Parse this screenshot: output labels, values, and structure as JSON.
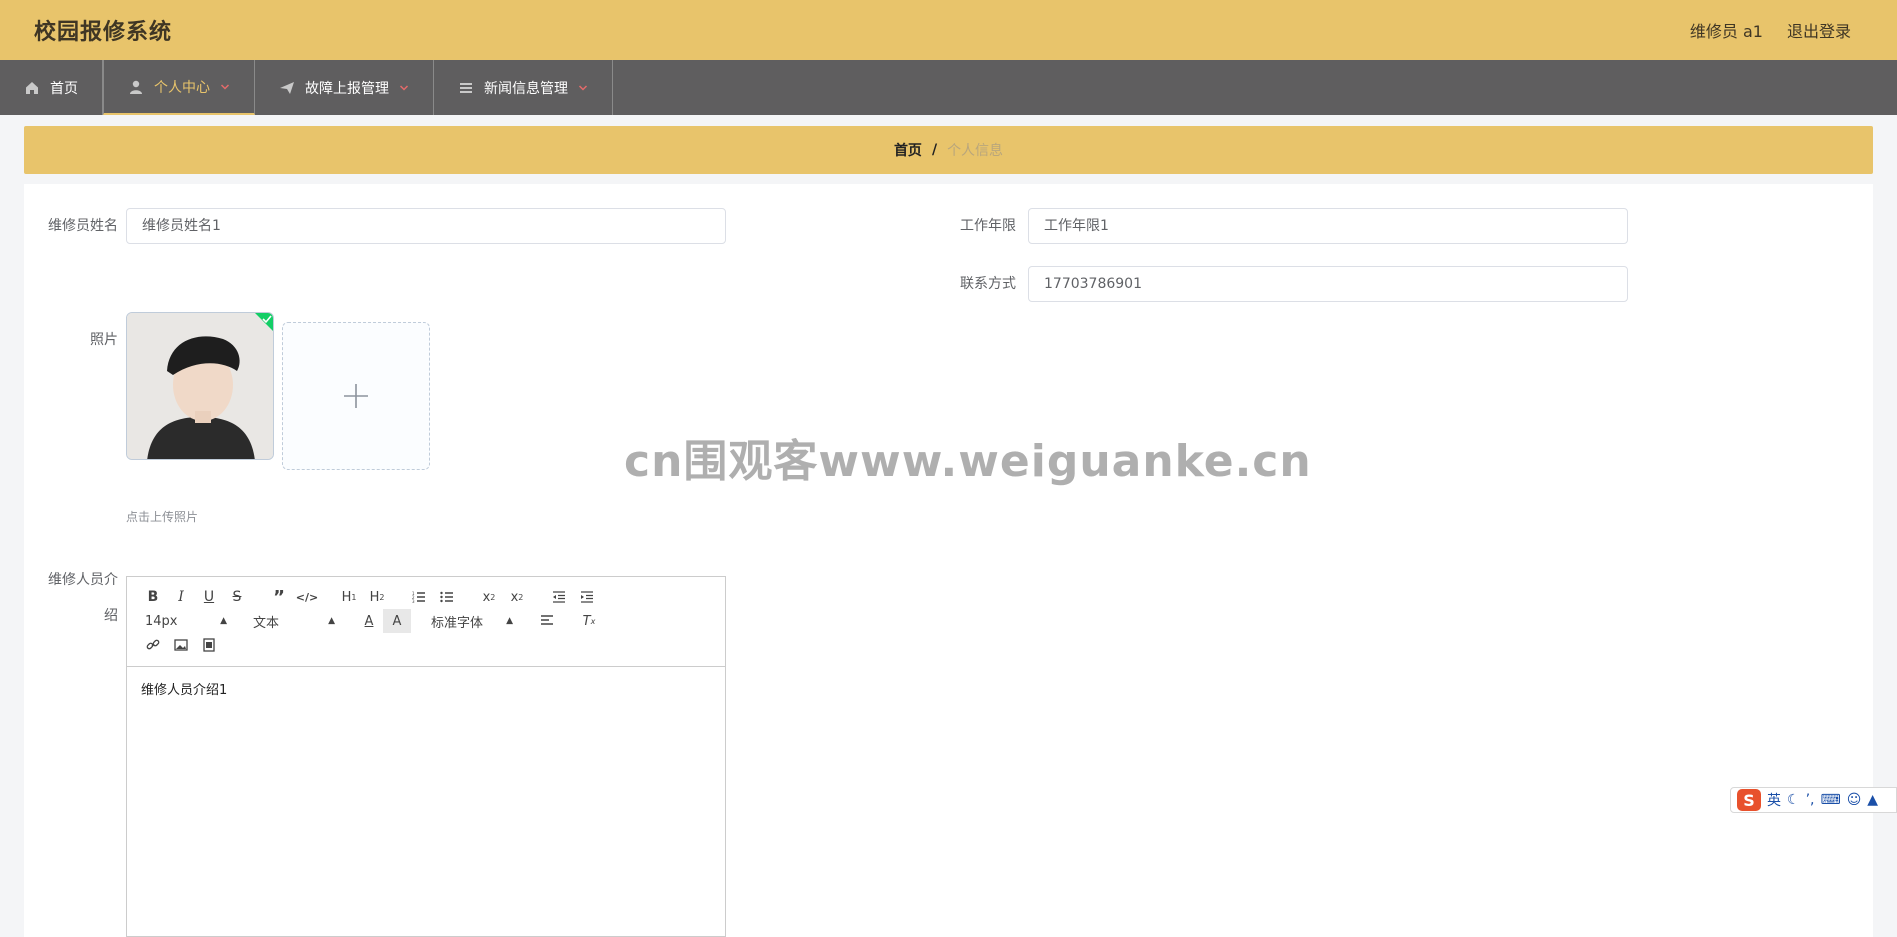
{
  "header": {
    "title": "校园报修系统",
    "user": "维修员 a1",
    "logout": "退出登录"
  },
  "nav": [
    {
      "label": "首页",
      "icon": "home-icon",
      "active": false
    },
    {
      "label": "个人中心",
      "icon": "user-icon",
      "active": true
    },
    {
      "label": "故障上报管理",
      "icon": "send-icon",
      "active": false
    },
    {
      "label": "新闻信息管理",
      "icon": "list-icon",
      "active": false
    }
  ],
  "breadcrumb": {
    "home": "首页",
    "separator": "/",
    "current": "个人信息"
  },
  "form": {
    "name_label": "维修员姓名",
    "name_value": "维修员姓名1",
    "years_label": "工作年限",
    "years_value": "工作年限1",
    "contact_label": "联系方式",
    "contact_value": "17703786901",
    "photo_label": "照片",
    "upload_hint": "点击上传照片",
    "intro_label": "维修人员介绍",
    "intro_value": "维修人员介绍1"
  },
  "editor": {
    "font_size": "14px",
    "text_type": "文本",
    "font_family": "标准字体"
  },
  "watermark": "cn围观客www.weiguanke.cn",
  "ime": {
    "logo": "S",
    "mode": "英"
  },
  "colors": {
    "accent": "#e8c46b",
    "nav_bg": "#5f5e5f",
    "success": "#13ce66"
  }
}
